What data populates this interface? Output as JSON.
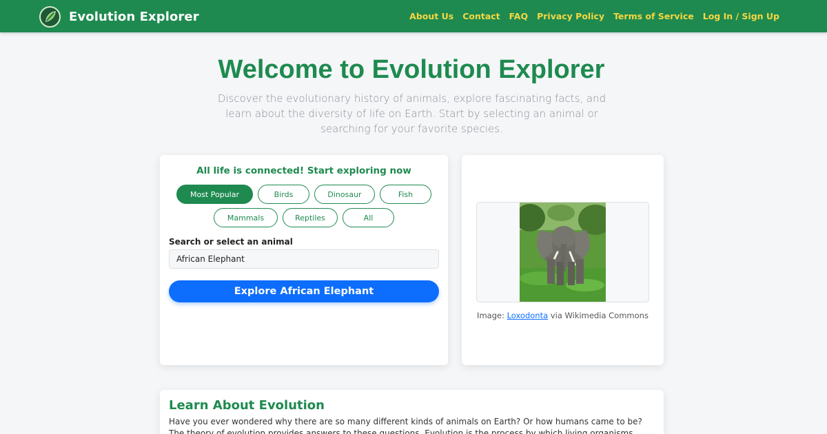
{
  "brand": {
    "title": "Evolution Explorer",
    "logo_icon": "leaf-icon"
  },
  "nav": {
    "links": [
      "About Us",
      "Contact",
      "FAQ",
      "Privacy Policy",
      "Terms of Service",
      "Log In / Sign Up"
    ]
  },
  "hero": {
    "title": "Welcome to Evolution Explorer",
    "subtitle": "Discover the evolutionary history of animals, explore fascinating facts, and learn about the diversity of life on Earth. Start by selecting an animal or searching for your favorite species."
  },
  "explorer": {
    "tagline": "All life is connected! Start exploring now",
    "categories_row1": [
      "Most Popular",
      "Birds",
      "Dinosaur",
      "Fish"
    ],
    "categories_row2": [
      "Mammals",
      "Reptiles",
      "All"
    ],
    "active_category": "Most Popular",
    "search_label": "Search or select an animal",
    "search_value": "African Elephant",
    "explore_button": "Explore African Elephant"
  },
  "image_card": {
    "caption_prefix": "Image: ",
    "caption_link": "Loxodonta",
    "caption_suffix": " via Wikimedia Commons"
  },
  "learn": {
    "title": "Learn About Evolution",
    "text": "Have you ever wondered why there are so many different kinds of animals on Earth? Or how humans came to be? The theory of evolution provides answers to these questions. Evolution is the process by which living organisms change"
  },
  "colors": {
    "primary_green": "#1e8a4f",
    "nav_link_yellow": "#f5d742",
    "button_blue": "#0d6efd",
    "page_background": "#f4f6f8"
  }
}
